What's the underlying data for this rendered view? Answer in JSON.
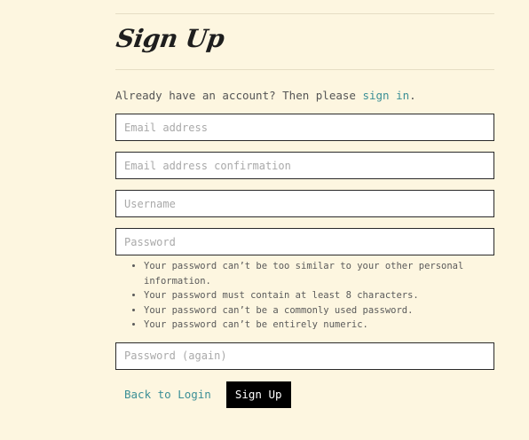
{
  "page": {
    "title": "Sign Up"
  },
  "intro": {
    "text_before": "Already have an account? Then please ",
    "sign_in_link": "sign in",
    "text_after": "."
  },
  "form": {
    "email_placeholder": "Email address",
    "email_value": "",
    "email_confirm_placeholder": "Email address confirmation",
    "email_confirm_value": "",
    "username_placeholder": "Username",
    "username_value": "",
    "password_placeholder": "Password",
    "password_value": "",
    "password_help": [
      "Your password can’t be too similar to your other personal information.",
      "Your password must contain at least 8 characters.",
      "Your password can’t be a commonly used password.",
      "Your password can’t be entirely numeric."
    ],
    "password2_placeholder": "Password (again)",
    "password2_value": ""
  },
  "actions": {
    "back_label": "Back to Login",
    "submit_label": "Sign Up"
  },
  "colors": {
    "background": "#fdf6e0",
    "link": "#3b8f96",
    "button": "#000000"
  }
}
